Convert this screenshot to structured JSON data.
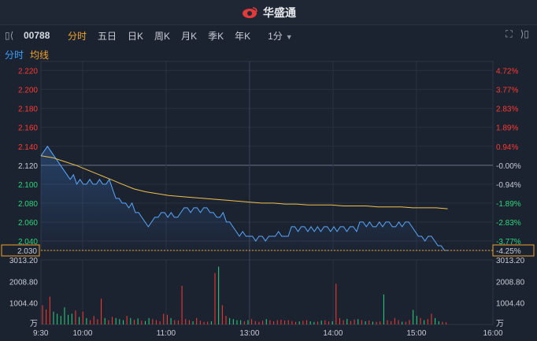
{
  "header": {
    "brand": "华盛通"
  },
  "toolbar": {
    "code": "00788",
    "tabs": [
      "分时",
      "五日",
      "日K",
      "周K",
      "月K",
      "季K",
      "年K"
    ],
    "active_tab": "分时",
    "interval": "1分"
  },
  "subtabs": {
    "time": "分时",
    "avg": "均线"
  },
  "colors": {
    "up": "#ff3b30",
    "down": "#2bd67b",
    "price": "#5aa9ff",
    "avg": "#f0c24a",
    "accent": "#f0a42b"
  },
  "chart_data": {
    "type": "line",
    "price_ticks": [
      "2.220",
      "2.200",
      "2.180",
      "2.160",
      "2.140",
      "2.120",
      "2.100",
      "2.080",
      "2.060",
      "2.040"
    ],
    "pct_ticks": [
      "4.72%",
      "3.77%",
      "2.83%",
      "1.89%",
      "0.94%",
      "-0.00%",
      "-0.94%",
      "-1.89%",
      "-2.83%",
      "-3.77%"
    ],
    "current_price": "2.030",
    "current_pct": "-4.25%",
    "prev_close": 2.12,
    "ylim": [
      2.03,
      2.223
    ],
    "x_labels": [
      "9:30",
      "10:00",
      "11:00",
      "13:00",
      "14:00",
      "15:00",
      "16:00"
    ],
    "volume_ticks": [
      "3013.20",
      "2008.80",
      "1004.40",
      "万"
    ],
    "volume_max": 3013.2,
    "price_series": [
      2.13,
      2.135,
      2.14,
      2.135,
      2.13,
      2.125,
      2.12,
      2.115,
      2.11,
      2.105,
      2.11,
      2.1,
      2.105,
      2.1,
      2.1,
      2.105,
      2.1,
      2.1,
      2.105,
      2.1,
      2.1,
      2.105,
      2.095,
      2.085,
      2.085,
      2.08,
      2.08,
      2.075,
      2.08,
      2.07,
      2.07,
      2.065,
      2.06,
      2.055,
      2.06,
      2.065,
      2.065,
      2.07,
      2.07,
      2.065,
      2.07,
      2.065,
      2.065,
      2.07,
      2.075,
      2.075,
      2.07,
      2.075,
      2.075,
      2.07,
      2.075,
      2.075,
      2.07,
      2.07,
      2.065,
      2.065,
      2.07,
      2.06,
      2.06,
      2.055,
      2.05,
      2.045,
      2.05,
      2.045,
      2.045,
      2.045,
      2.04,
      2.045,
      2.045,
      2.04,
      2.045,
      2.045,
      2.045,
      2.05,
      2.045,
      2.045,
      2.045,
      2.055,
      2.055,
      2.05,
      2.055,
      2.055,
      2.05,
      2.055,
      2.05,
      2.055,
      2.05,
      2.055,
      2.055,
      2.05,
      2.055,
      2.05,
      2.055,
      2.055,
      2.05,
      2.055,
      2.055,
      2.05,
      2.06,
      2.06,
      2.055,
      2.06,
      2.055,
      2.055,
      2.06,
      2.055,
      2.06,
      2.06,
      2.055,
      2.055,
      2.06,
      2.055,
      2.06,
      2.06,
      2.055,
      2.05,
      2.045,
      2.045,
      2.04,
      2.045,
      2.045,
      2.04,
      2.035,
      2.035,
      2.03,
      2.03
    ],
    "avg_series": [
      2.13,
      2.128,
      2.124,
      2.12,
      2.115,
      2.11,
      2.105,
      2.1,
      2.095,
      2.092,
      2.09,
      2.088,
      2.087,
      2.086,
      2.085,
      2.084,
      2.083,
      2.082,
      2.081,
      2.08,
      2.08,
      2.079,
      2.079,
      2.078,
      2.078,
      2.078,
      2.077,
      2.077,
      2.077,
      2.076,
      2.076,
      2.076,
      2.075,
      2.075,
      2.075,
      2.074
    ],
    "volumes": [
      900,
      700,
      1300,
      600,
      500,
      400,
      800,
      450,
      500,
      650,
      350,
      600,
      300,
      200,
      400,
      250,
      1200,
      300,
      200,
      350,
      300,
      250,
      200,
      400,
      300,
      220,
      280,
      180,
      160,
      300,
      250,
      200,
      150,
      500,
      450,
      300,
      200,
      180,
      1800,
      250,
      200,
      150,
      300,
      170,
      120,
      130,
      150,
      2400,
      2700,
      900,
      400,
      300,
      250,
      200,
      200,
      150,
      200,
      250,
      160,
      120,
      180,
      250,
      200,
      150,
      200,
      220,
      180,
      200,
      160,
      120,
      140,
      170,
      200,
      150,
      120,
      130,
      180,
      200,
      140,
      150,
      1900,
      300,
      200,
      260,
      160,
      230,
      250,
      200,
      150,
      180,
      130,
      120,
      140,
      1400,
      200,
      150,
      300,
      200,
      130,
      120,
      200,
      680,
      400,
      300,
      200,
      250,
      500,
      300,
      150,
      120,
      100
    ]
  }
}
